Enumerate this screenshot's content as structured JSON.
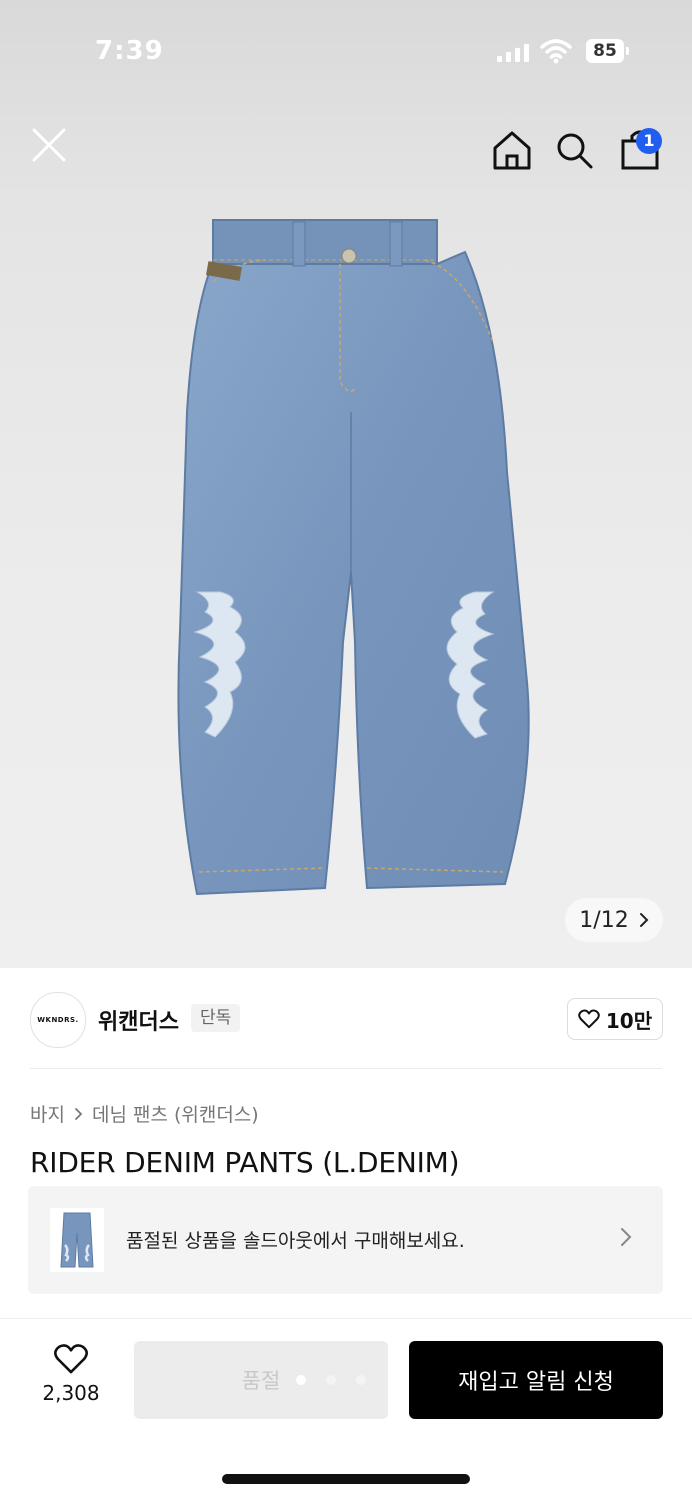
{
  "status_bar": {
    "time": "7:39",
    "battery": "85"
  },
  "header": {
    "close_icon": "close-icon",
    "home_icon": "home-icon",
    "search_icon": "search-icon",
    "cart_icon": "shopping-bag-icon",
    "cart_badge": "1"
  },
  "gallery": {
    "current": "1",
    "separator": "/",
    "total": "12"
  },
  "brand": {
    "logo_text": "WKNDRS.",
    "name": "위캔더스",
    "tag": "단독",
    "likes": "10만"
  },
  "breadcrumb": {
    "level1": "바지",
    "level2": "데님 팬츠 (위캔더스)"
  },
  "product": {
    "title": "RIDER DENIM PANTS (L.DENIM)"
  },
  "soldout_notice": {
    "text": "품절된 상품을 솔드아웃에서 구매해보세요."
  },
  "bottom_bar": {
    "wish_count": "2,308",
    "soldout_label": "품절",
    "restock_label": "재입고 알림 신청"
  },
  "colors": {
    "accent_blue": "#1f5ef0",
    "denim": "#7f9cc0",
    "primary_button": "#000000"
  }
}
